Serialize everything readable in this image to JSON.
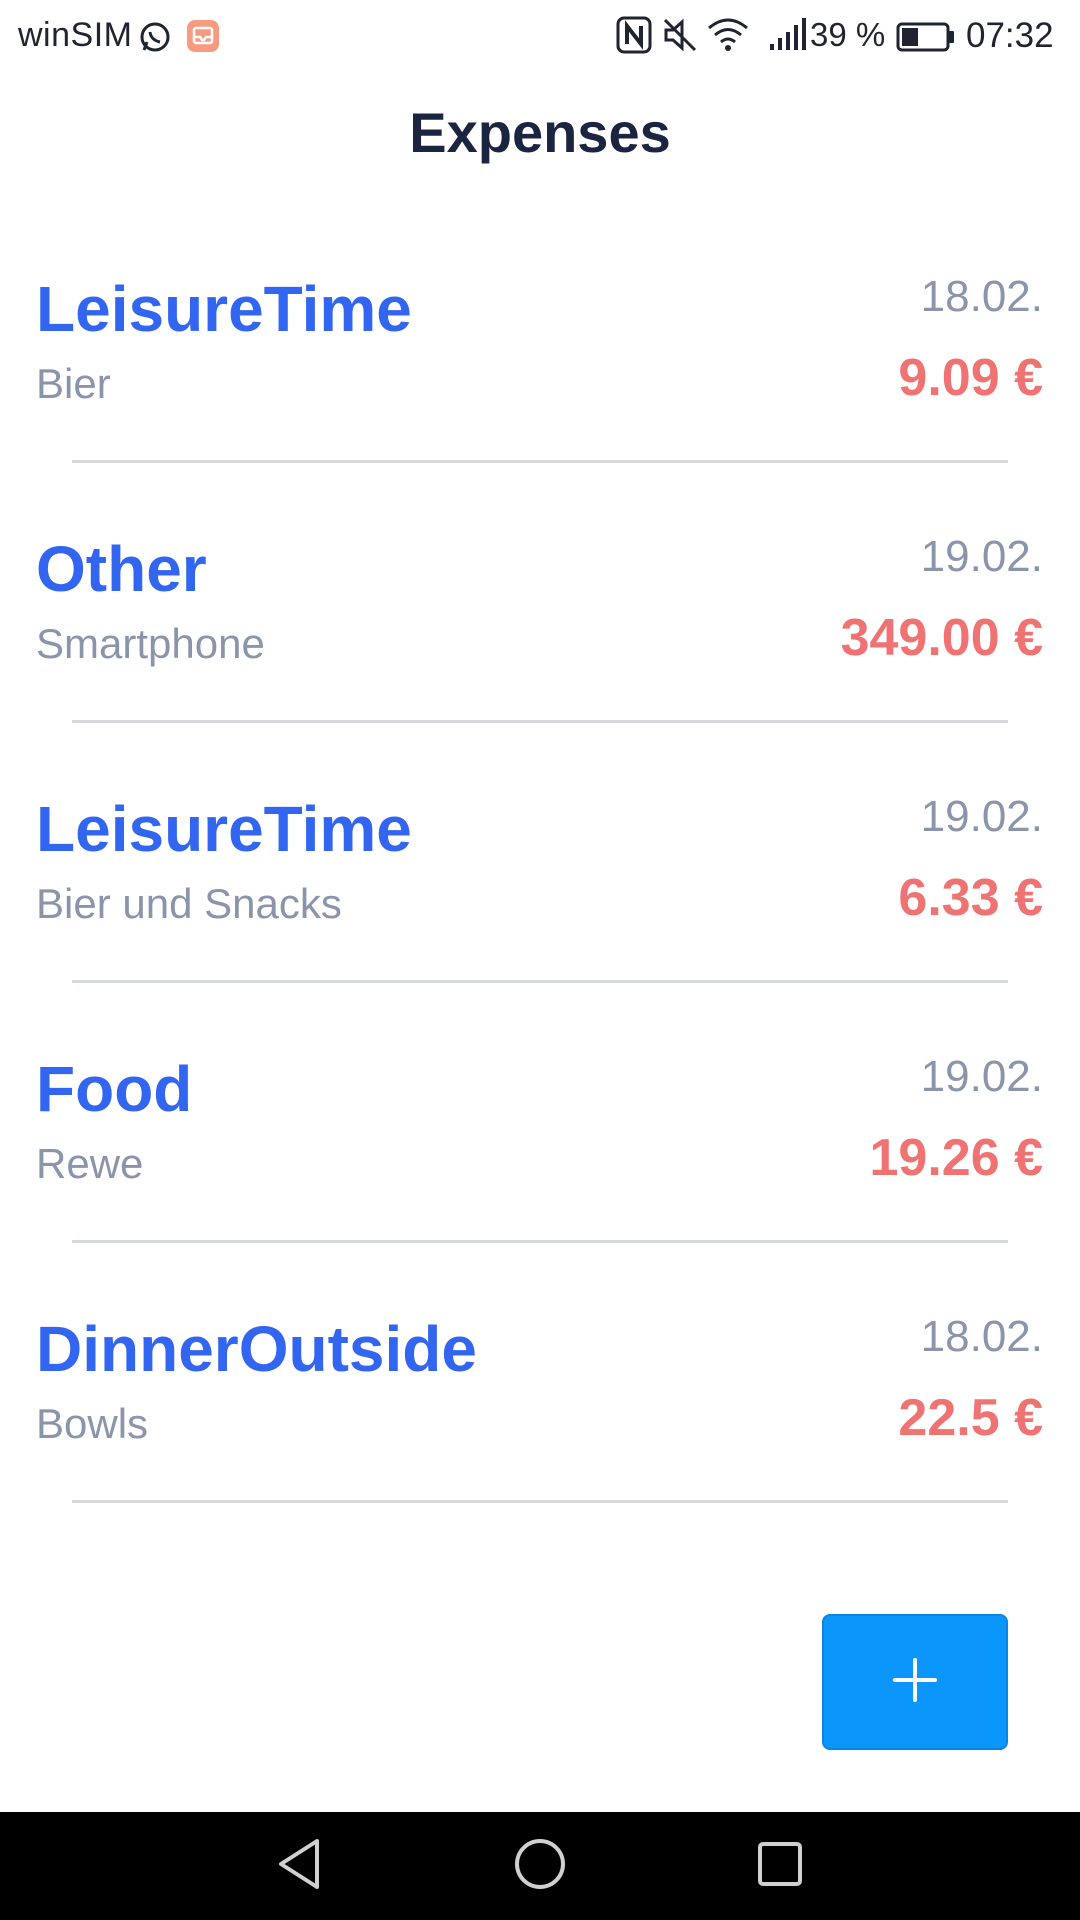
{
  "status_bar": {
    "carrier": "winSIM",
    "battery_percent": "39 %",
    "battery_level": 0.39,
    "time": "07:32",
    "icons": [
      "whatsapp-icon",
      "notification-icon",
      "nfc-icon",
      "mute-icon",
      "wifi-icon",
      "signal-icon",
      "battery-icon"
    ]
  },
  "header": {
    "title": "Expenses"
  },
  "expenses": [
    {
      "category": "LeisureTime",
      "description": "Bier",
      "date": "18.02.",
      "amount": "9.09 €"
    },
    {
      "category": "Other",
      "description": "Smartphone",
      "date": "19.02.",
      "amount": "349.00 €"
    },
    {
      "category": "LeisureTime",
      "description": "Bier und Snacks",
      "date": "19.02.",
      "amount": "6.33 €"
    },
    {
      "category": "Food",
      "description": "Rewe",
      "date": "19.02.",
      "amount": "19.26 €"
    },
    {
      "category": "DinnerOutside",
      "description": "Bowls",
      "date": "18.02.",
      "amount": "22.5 €"
    }
  ],
  "fab": {
    "icon": "plus-icon"
  },
  "nav": {
    "icons": [
      "back-icon",
      "home-icon",
      "recent-apps-icon"
    ]
  },
  "colors": {
    "category": "#3366f0",
    "amount": "#f07373",
    "secondary_text": "#8a94ab",
    "title": "#1b2440",
    "fab": "#0a96fa"
  }
}
